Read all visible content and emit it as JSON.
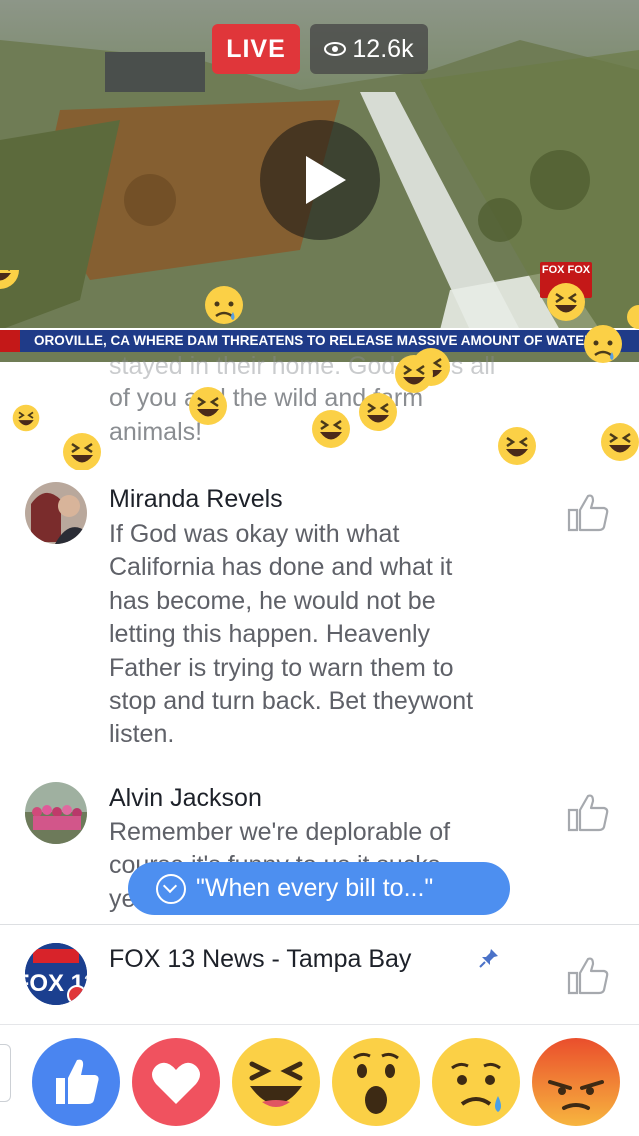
{
  "video": {
    "live_label": "LIVE",
    "viewer_count": "12.6k",
    "ticker_text": "OROVILLE, CA WHERE DAM THREATENS TO RELEASE MASSIVE AMOUNT OF WATER",
    "channel_logo_text": "FOX FOX"
  },
  "comments": {
    "partial": {
      "line1": "stayed in their home. God Bless all",
      "line2": "of you and the wild and farm",
      "line3": "animals!"
    },
    "items": [
      {
        "name": "Miranda Revels",
        "lines": [
          "If God was okay with what",
          "California has done and what it",
          "has become, he would not be",
          "letting this happen. Heavenly",
          "Father is trying to warn them to",
          "stop and turn back. Bet theywont",
          "listen."
        ]
      },
      {
        "name": "Alvin Jackson",
        "lines": [
          "Remember we're deplorable of",
          "course it's funny to us it sucks",
          "ye"
        ]
      }
    ]
  },
  "jump_pill": {
    "label": "\"When every bill to...\""
  },
  "page": {
    "name": "FOX 13 News - Tampa Bay",
    "avatar_text": "FOX 13"
  },
  "reactions": [
    "like",
    "love",
    "haha",
    "wow",
    "sad",
    "angry"
  ],
  "colors": {
    "live_red": "#e0363a",
    "link_blue": "#4d8ff0",
    "ticker_blue": "#1f3b88",
    "like_blue": "#4a85f0",
    "love_red": "#f0525f",
    "emoji_yellow": "#fbd046",
    "angry_red": "#ea4e2c"
  }
}
